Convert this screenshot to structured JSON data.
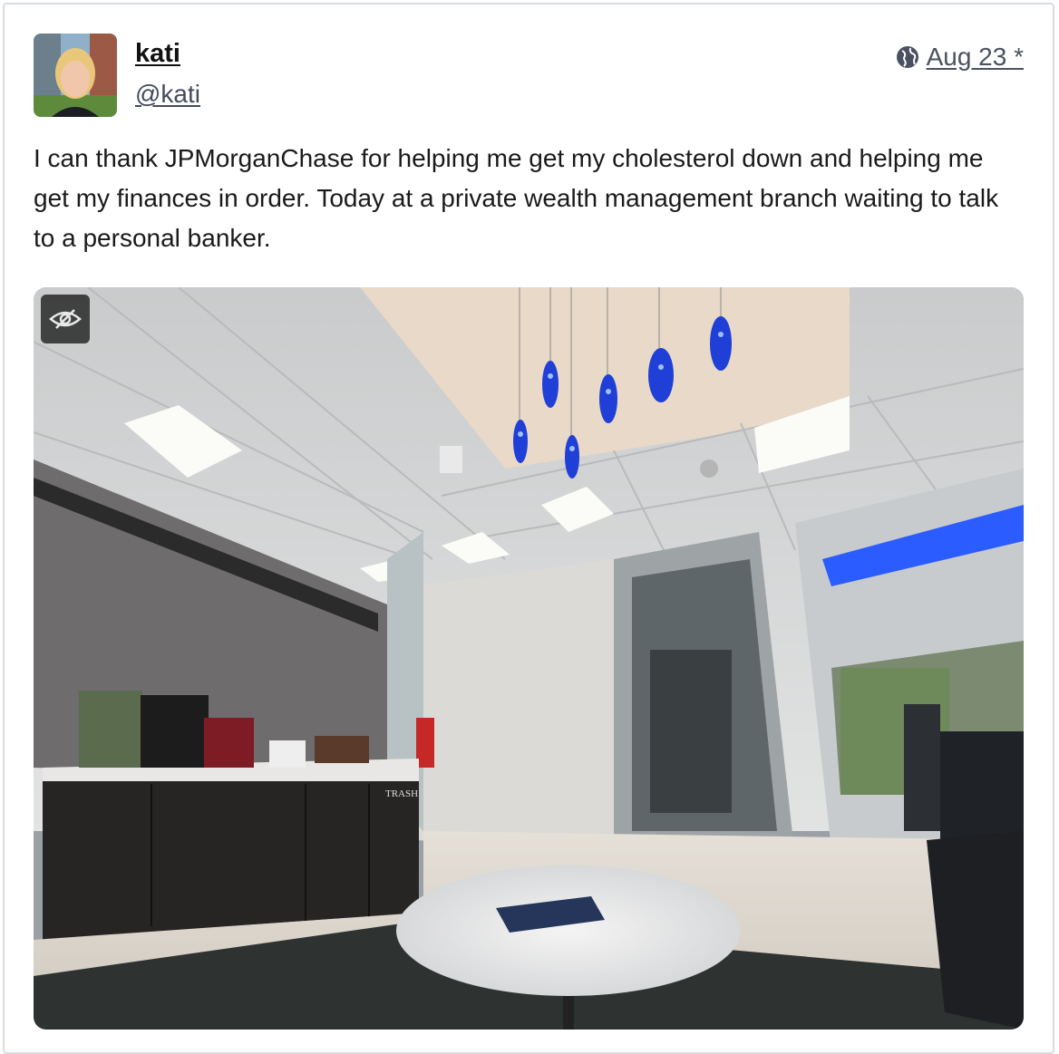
{
  "post": {
    "display_name": "kati",
    "handle": "@kati",
    "date": "Aug 23 *",
    "visibility_icon": "globe-icon",
    "body": "I can thank JPMorganChase for helping me get my cholesterol down and helping me get my finances in order. Today at a private wealth management branch waiting to talk to a personal banker.",
    "media_toggle_icon": "eye-slash-icon",
    "trash_sign": "TRASH"
  },
  "colors": {
    "link": "#444b5a",
    "pendant_light": "#1f3fd6",
    "accent_glow": "#2b5cff"
  }
}
